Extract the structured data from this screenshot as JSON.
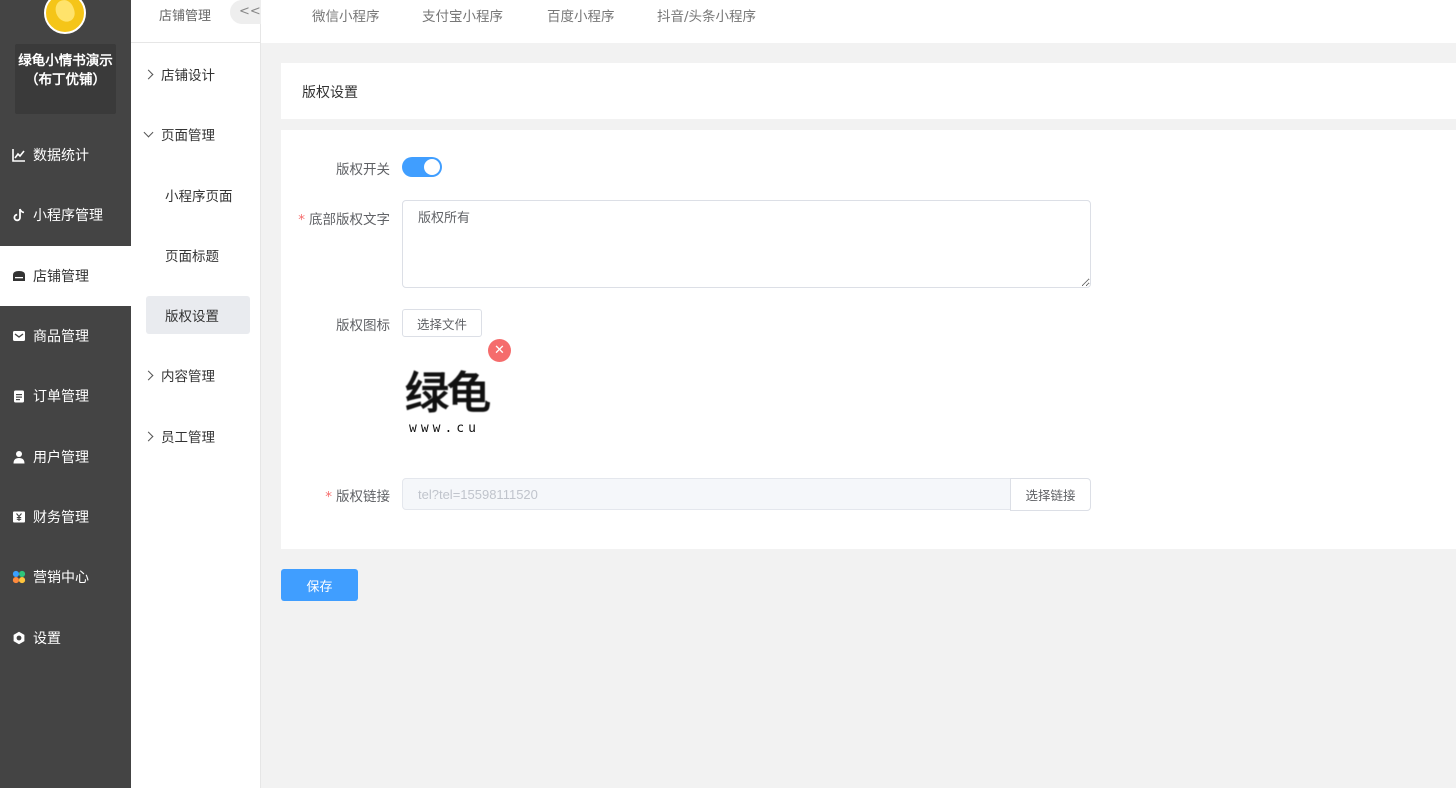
{
  "sidebar": {
    "shop_name": "绿龟小情书演示（布丁优铺）",
    "items": [
      {
        "label": "数据统计",
        "icon": "chart-line-icon"
      },
      {
        "label": "小程序管理",
        "icon": "tiktok-icon"
      },
      {
        "label": "店铺管理",
        "icon": "shop-icon"
      },
      {
        "label": "商品管理",
        "icon": "goods-box-icon"
      },
      {
        "label": "订单管理",
        "icon": "clipboard-icon"
      },
      {
        "label": "用户管理",
        "icon": "user-icon"
      },
      {
        "label": "财务管理",
        "icon": "yen-icon"
      },
      {
        "label": "营销中心",
        "icon": "marketing-icon"
      },
      {
        "label": "设置",
        "icon": "gear-icon"
      }
    ],
    "active": "店铺管理"
  },
  "sub_sidebar": {
    "title": "店铺管理",
    "collapse_label": "<<",
    "groups": [
      {
        "label": "店铺设计",
        "expanded": false
      },
      {
        "label": "页面管理",
        "expanded": true,
        "children": [
          "小程序页面",
          "页面标题",
          "版权设置"
        ]
      },
      {
        "label": "内容管理",
        "expanded": false
      },
      {
        "label": "员工管理",
        "expanded": false
      }
    ],
    "active_child": "版权设置"
  },
  "tabs": [
    "微信小程序",
    "支付宝小程序",
    "百度小程序",
    "抖音/头条小程序"
  ],
  "panel": {
    "title": "版权设置"
  },
  "form": {
    "switch_label": "版权开关",
    "switch_on": true,
    "text_label": "底部版权文字",
    "text_value": "版权所有",
    "icon_label": "版权图标",
    "choose_file_label": "选择文件",
    "link_label": "版权链接",
    "link_value": "tel?tel=15598111520",
    "choose_link_label": "选择链接",
    "save_label": "保存"
  },
  "logo_preview": {
    "big_text": "绿龟",
    "small_text": "www.cu"
  },
  "colors": {
    "sidebar_bg": "#444444",
    "primary": "#409eff",
    "danger": "#f56c6c"
  }
}
